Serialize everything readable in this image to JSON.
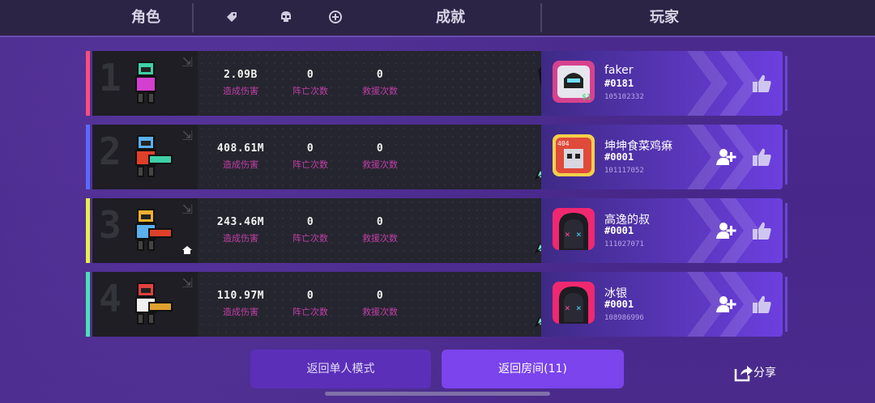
{
  "header": {
    "tab_character": "角色",
    "tab_achievement": "成就",
    "tab_player": "玩家",
    "filter_icons": [
      "tag-icon",
      "skull-icon",
      "plus-circle-icon"
    ]
  },
  "rows": [
    {
      "rank": "1",
      "accent_color": "#ff4d7a",
      "damage": "2.09B",
      "damage_label": "造成伤害",
      "deaths": "0",
      "deaths_label": "阵亡次数",
      "rescues": "0",
      "rescues_label": "救援次数",
      "achievements": [
        "wolf-badge-icon",
        "cheese-badge-icon"
      ],
      "player": {
        "name": "faker",
        "tag": "#0181",
        "id": "105102332"
      },
      "show_add_friend": false
    },
    {
      "rank": "2",
      "accent_color": "#5a6bff",
      "damage": "408.61M",
      "damage_label": "造成伤害",
      "deaths": "0",
      "deaths_label": "阵亡次数",
      "rescues": "0",
      "rescues_label": "救援次数",
      "achievements": [
        "fish-badge-icon"
      ],
      "player": {
        "name": "坤坤食菜鸡痳",
        "tag": "#0001",
        "id": "101117052"
      },
      "show_add_friend": true
    },
    {
      "rank": "3",
      "accent_color": "#e6f04a",
      "damage": "243.46M",
      "damage_label": "造成伤害",
      "deaths": "0",
      "deaths_label": "阵亡次数",
      "rescues": "0",
      "rescues_label": "救援次数",
      "achievements": [
        "fish-badge-icon"
      ],
      "player": {
        "name": "高逸的叔",
        "tag": "#0001",
        "id": "111027071"
      },
      "show_add_friend": true,
      "is_host": true
    },
    {
      "rank": "4",
      "accent_color": "#4de0b8",
      "damage": "110.97M",
      "damage_label": "造成伤害",
      "deaths": "0",
      "deaths_label": "阵亡次数",
      "rescues": "0",
      "rescues_label": "救援次数",
      "achievements": [
        "fish-badge-icon"
      ],
      "player": {
        "name": "冰银",
        "tag": "#0001",
        "id": "108986996"
      },
      "show_add_friend": true
    }
  ],
  "footer": {
    "single_mode_label": "返回单人模式",
    "room_label": "返回房间(11)",
    "share_label": "分享"
  }
}
